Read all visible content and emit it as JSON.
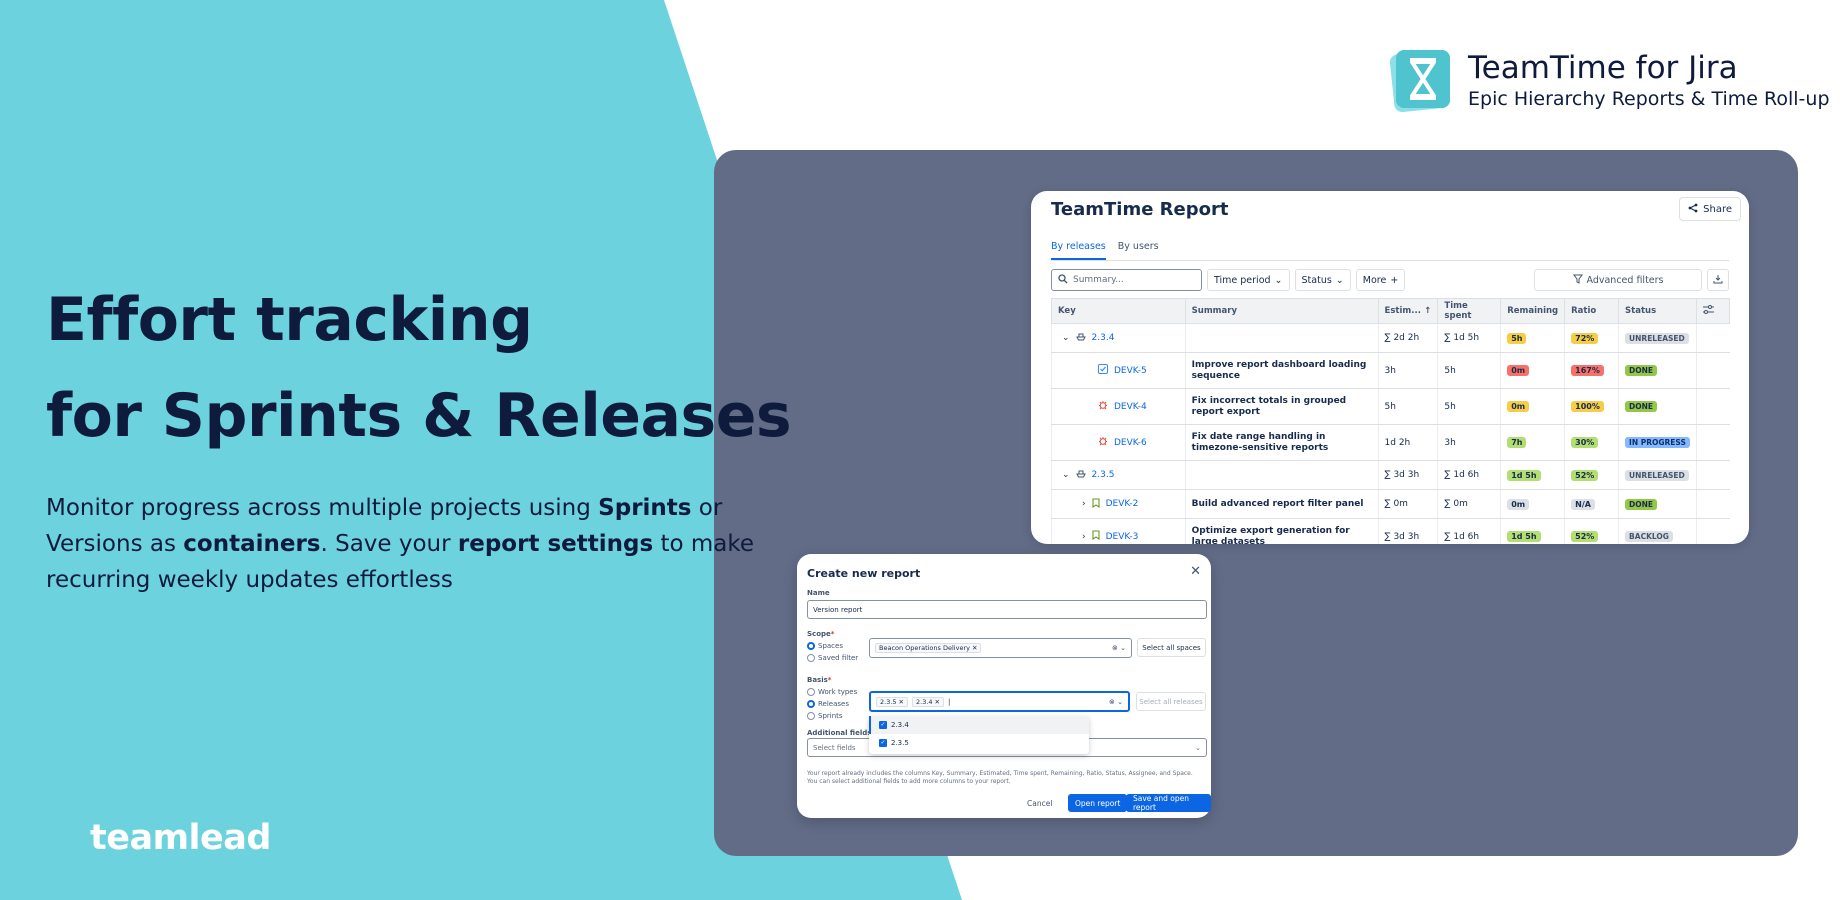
{
  "brand": {
    "title": "TeamTime for Jira",
    "subtitle": "Epic Hierarchy Reports & Time Roll-up"
  },
  "hero": {
    "title_line1": "Effort tracking",
    "title_line2": "for Sprints & Releases",
    "desc_1": "Monitor progress across multiple projects using ",
    "desc_b1": "Sprints",
    "desc_2": " or Versions as ",
    "desc_b2": "containers",
    "desc_3": ". Save your ",
    "desc_b3": "report settings",
    "desc_4": " to make recurring weekly updates effortless"
  },
  "footer_logo": "teamlead",
  "colors": {
    "cyan": "#6cd3de",
    "navy": "#0f1b3d",
    "panel": "#626c87",
    "link": "#0c66e4"
  },
  "report": {
    "title": "TeamTime Report",
    "share_label": "Share",
    "tabs": [
      {
        "label": "By releases",
        "active": true
      },
      {
        "label": "By users",
        "active": false
      }
    ],
    "search_placeholder": "Summary...",
    "filters": {
      "time_period": "Time period",
      "status": "Status",
      "more": "More",
      "advanced": "Advanced filters"
    },
    "columns": {
      "key": "Key",
      "summary": "Summary",
      "estimated": "Estim...",
      "time_spent": "Time spent",
      "remaining": "Remaining",
      "ratio": "Ratio",
      "status": "Status"
    },
    "rows": [
      {
        "key": "2.3.4",
        "summary": "",
        "estimated": "∑ 2d 2h",
        "spent": "∑ 1d 5h",
        "remaining": "5h",
        "ratio": "72%",
        "status": "UNRELEASED"
      },
      {
        "key": "DEVK-5",
        "summary": "Improve report dashboard loading sequence",
        "estimated": "3h",
        "spent": "5h",
        "remaining": "0m",
        "ratio": "167%",
        "status": "DONE"
      },
      {
        "key": "DEVK-4",
        "summary": "Fix incorrect totals in grouped report export",
        "estimated": "5h",
        "spent": "5h",
        "remaining": "0m",
        "ratio": "100%",
        "status": "DONE"
      },
      {
        "key": "DEVK-6",
        "summary": "Fix date range handling in timezone-sensitive reports",
        "estimated": "1d 2h",
        "spent": "3h",
        "remaining": "7h",
        "ratio": "30%",
        "status": "IN PROGRESS"
      },
      {
        "key": "2.3.5",
        "summary": "",
        "estimated": "∑ 3d 3h",
        "spent": "∑ 1d 6h",
        "remaining": "1d 5h",
        "ratio": "52%",
        "status": "UNRELEASED"
      },
      {
        "key": "DEVK-2",
        "summary": "Build advanced report filter panel",
        "estimated": "∑ 0m",
        "spent": "∑ 0m",
        "remaining": "0m",
        "ratio": "N/A",
        "status": "DONE"
      },
      {
        "key": "DEVK-3",
        "summary": "Optimize export generation for large datasets",
        "estimated": "∑ 3d 3h",
        "spent": "∑ 1d 6h",
        "remaining": "1d 5h",
        "ratio": "52%",
        "status": "BACKLOG"
      }
    ]
  },
  "dialog": {
    "title": "Create new report",
    "name_label": "Name",
    "name_value": "Version report",
    "scope_label": "Scope",
    "scope_options": [
      "Spaces",
      "Saved filter"
    ],
    "scope_chip": "Beacon Operations Delivery",
    "select_all_spaces": "Select all spaces",
    "basis_label": "Basis",
    "basis_options": [
      "Work types",
      "Releases",
      "Sprints"
    ],
    "basis_chips": [
      "2.3.5",
      "2.3.4"
    ],
    "select_all_releases": "Select all releases",
    "dropdown_options": [
      "2.3.4",
      "2.3.5"
    ],
    "additional_label": "Additional fields o",
    "select_fields_placeholder": "Select fields",
    "help_text": "Your report already includes the columns Key, Summary, Estimated, Time spent, Remaining, Ratio, Status, Assignee, and Space. You can select additional fields to add more columns to your report.",
    "cancel": "Cancel",
    "open_report": "Open report",
    "save_open": "Save and open report"
  }
}
